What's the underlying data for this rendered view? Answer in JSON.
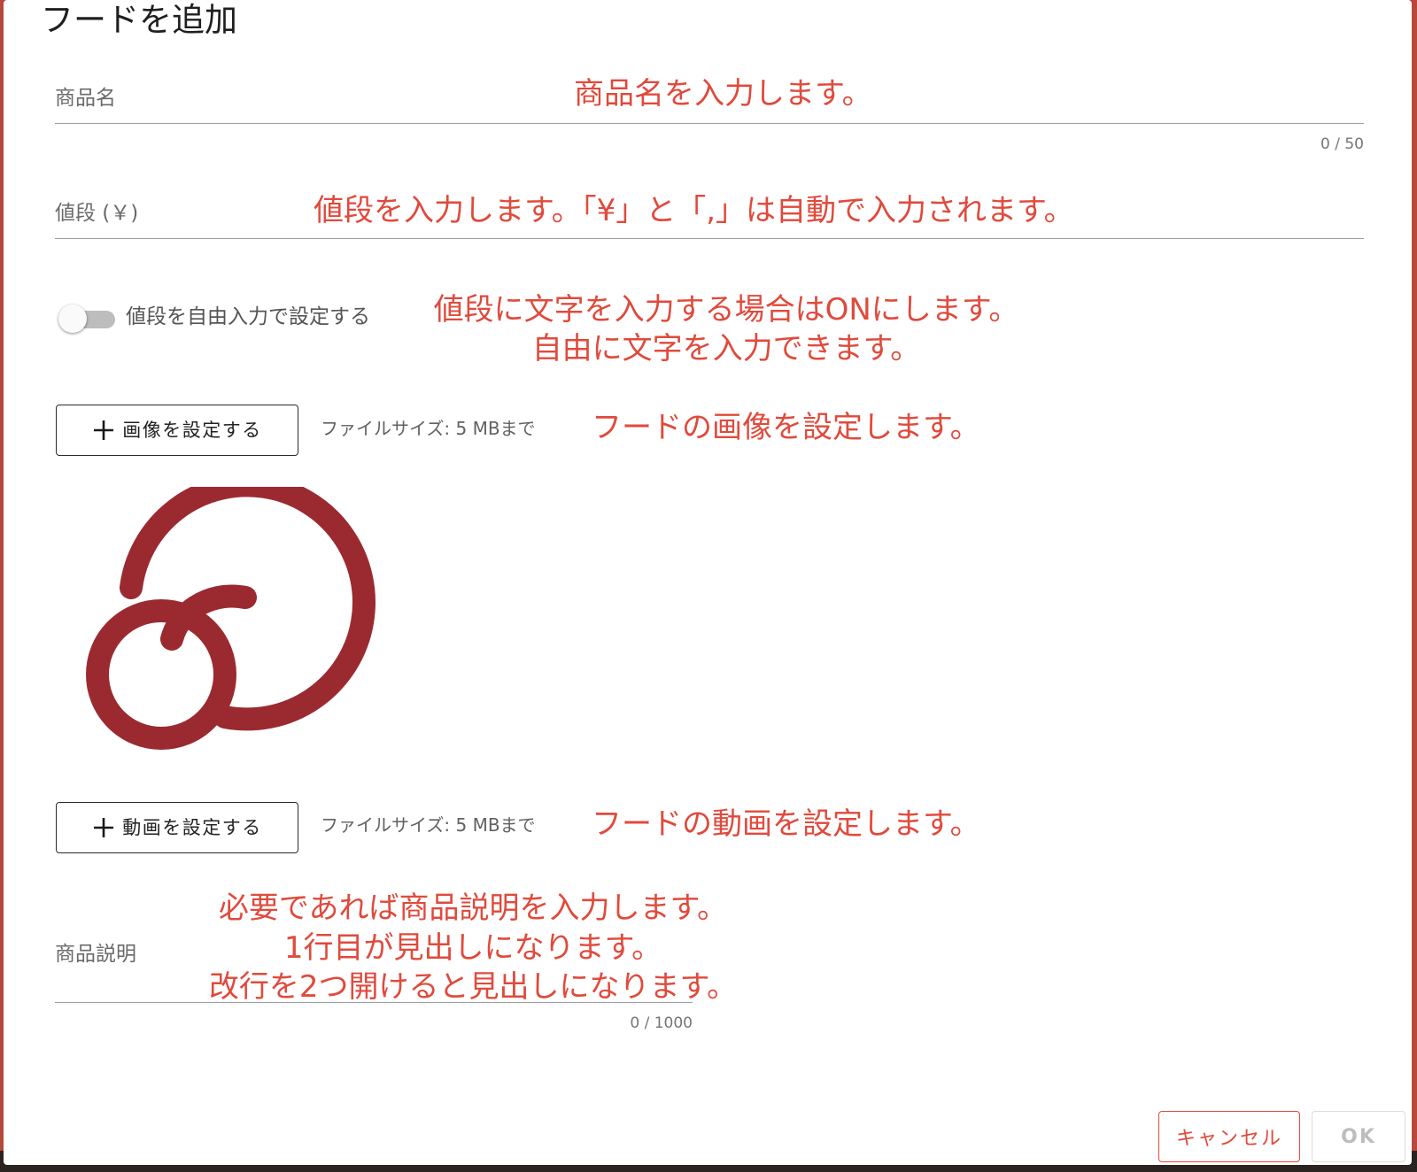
{
  "dialog": {
    "title": "フードを追加",
    "name_field": {
      "label": "商品名",
      "counter": "0 / 50",
      "annotation": "商品名を入力します。"
    },
    "price_field": {
      "label": "値段 (￥)",
      "annotation": "値段を入力します。「¥」と「,」は自動で入力されます。"
    },
    "free_price_toggle": {
      "label": "値段を自由入力で設定する",
      "state": "off",
      "annotation_line1": "値段に文字を入力する場合はONにします。",
      "annotation_line2": "自由に文字を入力できます。"
    },
    "image_upload": {
      "button_label": "画像を設定する",
      "hint": "ファイルサイズ: 5 MBまで",
      "annotation": "フードの画像を設定します。"
    },
    "video_upload": {
      "button_label": "動画を設定する",
      "hint": "ファイルサイズ: 5 MBまで",
      "annotation": "フードの動画を設定します。"
    },
    "description_field": {
      "label": "商品説明",
      "counter": "0 / 1000",
      "annotation_line1": "必要であれば商品説明を入力します。",
      "annotation_line2": "1行目が見出しになります。",
      "annotation_line3": "改行を2つ開けると見出しになります。"
    },
    "actions": {
      "cancel_label": "キャンセル",
      "ok_label": "OK"
    }
  },
  "colors": {
    "annotation": "#e04a3c",
    "logo": "#9b2a30",
    "backdrop": "#b6483c"
  },
  "icons": {
    "plus": "plus-icon",
    "preview": "logo-image"
  }
}
